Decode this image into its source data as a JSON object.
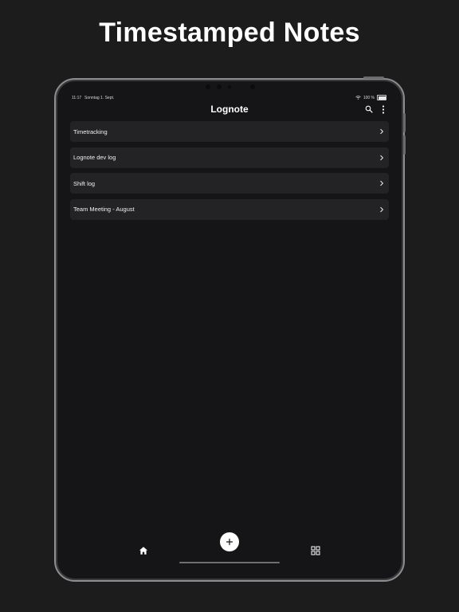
{
  "promo": {
    "headline": "Timestamped Notes"
  },
  "status_bar": {
    "time": "11:17",
    "date": "Sonntag 1. Sept.",
    "battery": "100 %"
  },
  "header": {
    "title": "Lognote",
    "search_icon": "search-icon",
    "menu_icon": "more-vertical-icon"
  },
  "notes": [
    {
      "label": "Timetracking"
    },
    {
      "label": "Lognote dev log"
    },
    {
      "label": "Shift log"
    },
    {
      "label": "Team Meeting - August"
    }
  ],
  "bottom_nav": {
    "home_icon": "home-icon",
    "add_icon": "plus-icon",
    "grid_icon": "grid-icon"
  },
  "colors": {
    "background": "#1c1c1d",
    "screen": "#151517",
    "card": "#232325",
    "text": "#f0f0f0",
    "accent": "#ffffff"
  }
}
